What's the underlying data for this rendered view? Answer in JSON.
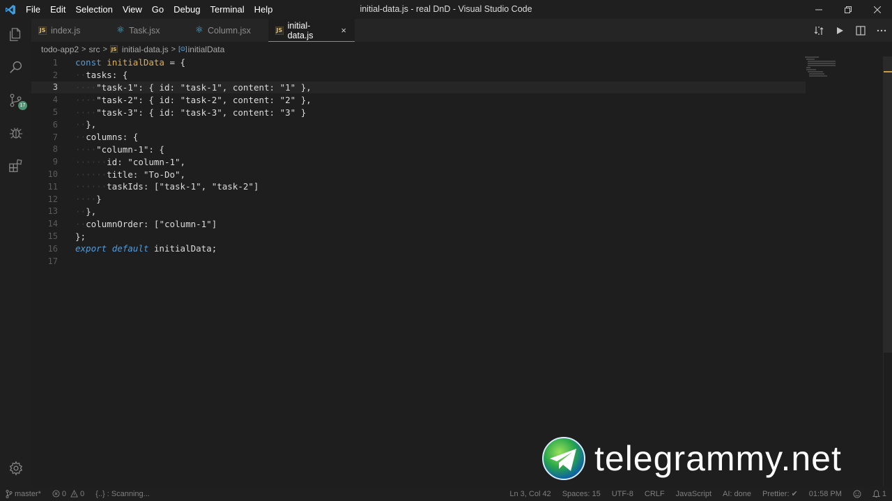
{
  "window": {
    "title": "initial-data.js - real DnD - Visual Studio Code"
  },
  "menu": [
    "File",
    "Edit",
    "Selection",
    "View",
    "Go",
    "Debug",
    "Terminal",
    "Help"
  ],
  "activity": {
    "scm_badge": "17"
  },
  "tabs": [
    {
      "label": "index.js",
      "icon": "js-icon",
      "icon_text": "JS"
    },
    {
      "label": "Task.jsx",
      "icon": "react-icon",
      "icon_text": "⚛"
    },
    {
      "label": "Column.jsx",
      "icon": "react-icon",
      "icon_text": "⚛"
    },
    {
      "label": "initial-data.js",
      "icon": "js-icon",
      "icon_text": "JS",
      "close": "×"
    }
  ],
  "breadcrumb": [
    "todo-app2",
    "src",
    "initial-data.js",
    "initialData"
  ],
  "breadcrumb_sep": ">",
  "breadcrumb_file_icon": "JS",
  "breadcrumb_symbol_icon": "[⊙]",
  "editor": {
    "current_line": 3,
    "line_numbers": [
      "1",
      "2",
      "3",
      "4",
      "5",
      "6",
      "7",
      "8",
      "9",
      "10",
      "11",
      "12",
      "13",
      "14",
      "15",
      "16",
      "17"
    ]
  },
  "watermark": {
    "text": "telegrammy.net"
  },
  "status": {
    "branch": "master*",
    "errors": "0",
    "warnings": "0",
    "scanning": "{..} : Scanning...",
    "position": "Ln 3, Col 42",
    "spaces": "Spaces: 15",
    "encoding": "UTF-8",
    "eol": "CRLF",
    "language": "JavaScript",
    "ai": "AI: done",
    "prettier": "Prettier: ✔",
    "time": "01:58 PM",
    "notifications": "1"
  },
  "colors": {
    "accent": "#4f9ad6",
    "keyword": "#569cd6",
    "string": "#ce9178",
    "variable": "#dcdcaa",
    "scm_badge": "#4d9375"
  }
}
